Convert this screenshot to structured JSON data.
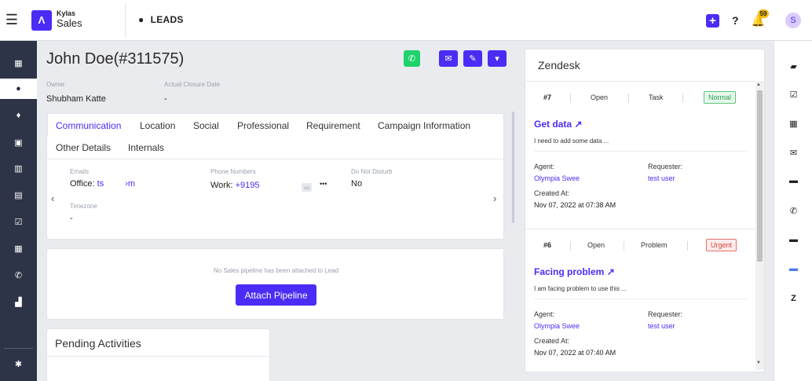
{
  "topbar": {
    "menu_icon": "hamburger-icon",
    "brand_top": "Kylas",
    "brand_bottom": "Sales",
    "module_label": "LEADS",
    "notification_count": "59",
    "avatar_initial": "S"
  },
  "leftnav": {
    "items": [
      "dashboard-icon",
      "user-icon",
      "deals-icon",
      "contacts-icon",
      "company-icon",
      "products-icon",
      "tasks-icon",
      "calendar-icon",
      "phone-icon",
      "reports-icon"
    ],
    "bottom": "gear-icon"
  },
  "record": {
    "title": "John Doe(#311575)",
    "owner_label": "Owner",
    "owner_value": "Shubham Katte",
    "closure_label": "Actual Closure Date",
    "closure_value": "-"
  },
  "tabs": [
    "Communication",
    "Location",
    "Social",
    "Professional",
    "Requirement",
    "Campaign Information",
    "Other Details",
    "Internals"
  ],
  "communication": {
    "emails_label": "Emails",
    "email_prefix": "Office: ",
    "email_part1": "ts",
    "email_part2": "›m",
    "phones_label": "Phone Numbers",
    "phone_prefix": "Work: ",
    "phone_value": "+9195",
    "phone_more": "•••",
    "dnd_label": "Do Not Disturb",
    "dnd_value": "No",
    "timezone_label": "Timezone",
    "timezone_value": "-"
  },
  "pipeline": {
    "message": "No Sales pipeline has been attached to Lead",
    "button": "Attach Pipeline"
  },
  "pending": {
    "title": "Pending Activities"
  },
  "zendesk": {
    "title": "Zendesk",
    "tickets": [
      {
        "id": "#7",
        "status": "Open",
        "type": "Task",
        "priority": "Normal",
        "subject": "Get data",
        "description": "I need to add some data ...",
        "agent_label": "Agent:",
        "agent": "Olympia Swee",
        "requester_label": "Requester:",
        "requester": "test user",
        "created_label": "Created At:",
        "created": "Nov 07, 2022 at 07:38 AM"
      },
      {
        "id": "#6",
        "status": "Open",
        "type": "Problem",
        "priority": "Urgent",
        "subject": "Facing problem",
        "description": "I am facing problem to use this ...",
        "agent_label": "Agent:",
        "agent": "Olympia Swee",
        "requester_label": "Requester:",
        "requester": "test user",
        "created_label": "Created At:",
        "created": "Nov 07, 2022 at 07:40 AM"
      }
    ]
  },
  "rightrail": {
    "items": [
      "notes-icon",
      "task-icon",
      "calendar-icon",
      "email-icon",
      "chat-icon",
      "phone-icon",
      "folder-icon",
      "messenger-icon",
      "zendesk-icon"
    ]
  }
}
